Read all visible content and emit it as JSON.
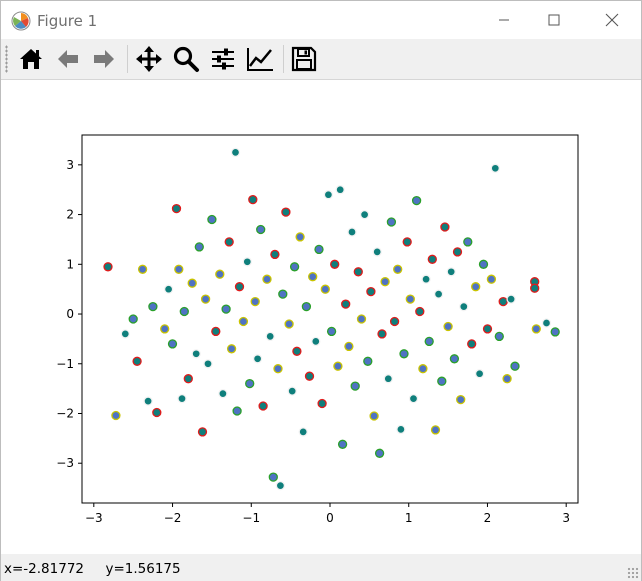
{
  "window": {
    "title": "Figure 1",
    "minimize_glyph": "—",
    "maximize_glyph": "☐",
    "close_glyph": "✕"
  },
  "toolbar": {
    "tools": [
      {
        "name": "home-icon",
        "tooltip": "Reset original view"
      },
      {
        "name": "back-arrow-icon",
        "tooltip": "Back to previous view"
      },
      {
        "name": "forward-arrow-icon",
        "tooltip": "Forward to next view"
      },
      {
        "name": "pan-move-icon",
        "tooltip": "Pan axes"
      },
      {
        "name": "zoom-magnifier-icon",
        "tooltip": "Zoom to rectangle"
      },
      {
        "name": "subplots-sliders-icon",
        "tooltip": "Configure subplots"
      },
      {
        "name": "edit-axes-chart-icon",
        "tooltip": "Edit axis, curve and image parameters"
      },
      {
        "name": "save-floppy-icon",
        "tooltip": "Save the figure"
      }
    ]
  },
  "status": {
    "coords_text": "x=-2.81772     y=1.56175"
  },
  "colors": {
    "teal_fill": "#0f7f7c",
    "blue_fill": "#4f73c3",
    "red_edge": "#e01b1b",
    "yellow_edge": "#c9c400",
    "white_edge": "#f2f2f2"
  },
  "chart_data": {
    "type": "scatter",
    "title": "",
    "xlabel": "",
    "ylabel": "",
    "xlim": [
      -3.15,
      3.15
    ],
    "ylim": [
      -3.8,
      3.6
    ],
    "xticks": [
      -3,
      -2,
      -1,
      0,
      1,
      2,
      3
    ],
    "yticks": [
      -3,
      -2,
      -1,
      0,
      1,
      2,
      3
    ],
    "grid": false,
    "legend": "none",
    "series": [
      {
        "description": "random normal points, mixed teal/blue fills with red, yellow, white and green edges",
        "points": [
          [
            -2.82,
            0.95
          ],
          [
            -2.72,
            -2.04
          ],
          [
            -2.6,
            -0.4
          ],
          [
            -2.5,
            -0.1
          ],
          [
            -2.45,
            -0.95
          ],
          [
            -2.38,
            0.9
          ],
          [
            -2.31,
            -1.75
          ],
          [
            -2.25,
            0.15
          ],
          [
            -2.2,
            -1.98
          ],
          [
            -2.1,
            -0.3
          ],
          [
            -2.05,
            0.5
          ],
          [
            -2.0,
            -0.6
          ],
          [
            -1.95,
            2.12
          ],
          [
            -1.92,
            0.9
          ],
          [
            -1.88,
            -1.7
          ],
          [
            -1.85,
            0.05
          ],
          [
            -1.8,
            -1.3
          ],
          [
            -1.75,
            0.62
          ],
          [
            -1.7,
            -0.8
          ],
          [
            -1.66,
            1.35
          ],
          [
            -1.62,
            -2.37
          ],
          [
            -1.58,
            0.3
          ],
          [
            -1.55,
            -1.0
          ],
          [
            -1.5,
            1.9
          ],
          [
            -1.45,
            -0.35
          ],
          [
            -1.4,
            0.8
          ],
          [
            -1.36,
            -1.6
          ],
          [
            -1.32,
            0.1
          ],
          [
            -1.28,
            1.45
          ],
          [
            -1.25,
            -0.7
          ],
          [
            -1.2,
            3.25
          ],
          [
            -1.18,
            -1.95
          ],
          [
            -1.15,
            0.55
          ],
          [
            -1.1,
            -0.15
          ],
          [
            -1.05,
            1.05
          ],
          [
            -1.02,
            -1.4
          ],
          [
            -0.98,
            2.3
          ],
          [
            -0.95,
            0.25
          ],
          [
            -0.92,
            -0.9
          ],
          [
            -0.88,
            1.7
          ],
          [
            -0.85,
            -1.85
          ],
          [
            -0.8,
            0.7
          ],
          [
            -0.76,
            -0.45
          ],
          [
            -0.72,
            -3.28
          ],
          [
            -0.7,
            1.2
          ],
          [
            -0.66,
            -1.1
          ],
          [
            -0.63,
            -3.45
          ],
          [
            -0.6,
            0.4
          ],
          [
            -0.56,
            2.05
          ],
          [
            -0.52,
            -0.2
          ],
          [
            -0.48,
            -1.55
          ],
          [
            -0.45,
            0.95
          ],
          [
            -0.42,
            -0.75
          ],
          [
            -0.38,
            1.55
          ],
          [
            -0.34,
            -2.37
          ],
          [
            -0.3,
            0.15
          ],
          [
            -0.26,
            -1.25
          ],
          [
            -0.22,
            0.75
          ],
          [
            -0.18,
            -0.55
          ],
          [
            -0.14,
            1.3
          ],
          [
            -0.1,
            -1.8
          ],
          [
            -0.06,
            0.5
          ],
          [
            -0.02,
            2.4
          ],
          [
            0.02,
            -0.35
          ],
          [
            0.06,
            1.0
          ],
          [
            0.1,
            -1.05
          ],
          [
            0.13,
            2.5
          ],
          [
            0.16,
            -2.62
          ],
          [
            0.2,
            0.2
          ],
          [
            0.24,
            -0.65
          ],
          [
            0.28,
            1.65
          ],
          [
            0.32,
            -1.45
          ],
          [
            0.36,
            0.85
          ],
          [
            0.4,
            -0.1
          ],
          [
            0.44,
            2.0
          ],
          [
            0.48,
            -0.95
          ],
          [
            0.52,
            0.45
          ],
          [
            0.56,
            -2.05
          ],
          [
            0.6,
            1.25
          ],
          [
            0.63,
            -2.8
          ],
          [
            0.66,
            -0.4
          ],
          [
            0.7,
            0.65
          ],
          [
            0.74,
            -1.3
          ],
          [
            0.78,
            1.85
          ],
          [
            0.82,
            -0.15
          ],
          [
            0.86,
            0.9
          ],
          [
            0.9,
            -2.32
          ],
          [
            0.94,
            -0.8
          ],
          [
            0.98,
            1.45
          ],
          [
            1.02,
            0.3
          ],
          [
            1.06,
            -1.7
          ],
          [
            1.1,
            2.28
          ],
          [
            1.14,
            0.05
          ],
          [
            1.18,
            -1.1
          ],
          [
            1.22,
            0.7
          ],
          [
            1.26,
            -0.55
          ],
          [
            1.3,
            1.1
          ],
          [
            1.34,
            -2.33
          ],
          [
            1.38,
            0.4
          ],
          [
            1.42,
            -1.35
          ],
          [
            1.46,
            1.75
          ],
          [
            1.5,
            -0.25
          ],
          [
            1.54,
            0.85
          ],
          [
            1.58,
            -0.9
          ],
          [
            1.62,
            1.25
          ],
          [
            1.66,
            -1.72
          ],
          [
            1.7,
            0.15
          ],
          [
            1.75,
            1.45
          ],
          [
            1.8,
            -0.6
          ],
          [
            1.85,
            0.55
          ],
          [
            1.9,
            -1.2
          ],
          [
            1.95,
            1.0
          ],
          [
            2.0,
            -0.3
          ],
          [
            2.05,
            0.7
          ],
          [
            2.1,
            2.93
          ],
          [
            2.15,
            -0.45
          ],
          [
            2.2,
            0.25
          ],
          [
            2.25,
            -1.3
          ],
          [
            2.3,
            0.3
          ],
          [
            2.35,
            -1.05
          ],
          [
            2.6,
            0.65
          ],
          [
            2.62,
            -0.3
          ],
          [
            2.75,
            -0.18
          ],
          [
            2.86,
            -0.36
          ],
          [
            2.6,
            0.52
          ]
        ]
      }
    ]
  }
}
